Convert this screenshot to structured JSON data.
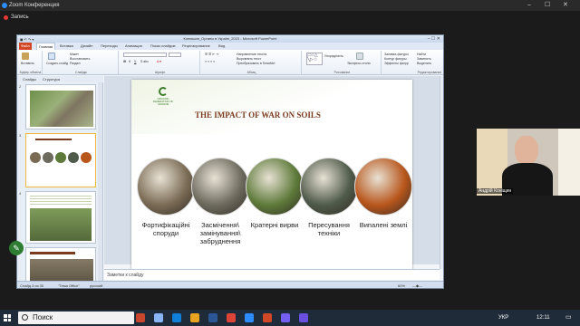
{
  "zoom": {
    "title": "Zoom Конференция",
    "recording_label": "Запись",
    "participant_name": "Андрій Коніщин",
    "window_controls": [
      "–",
      "☐",
      "✕"
    ]
  },
  "powerpoint": {
    "title": "Конюшин_Органік в Україні_2023 - Microsoft PowerPoint",
    "tabs": [
      "Файл",
      "Главная",
      "Вставка",
      "Дизайн",
      "Переходы",
      "Анимация",
      "Показ слайдов",
      "Рецензирование",
      "Вид"
    ],
    "active_tab": "Главная",
    "ribbon": {
      "groups": [
        "Буфер обмена",
        "Слайды",
        "Шрифт",
        "Абзац",
        "Рисование",
        "Редактирование"
      ],
      "buttons": {
        "paste": "Вставить",
        "create_slide": "Создать слайд",
        "layout": "Макет",
        "restore": "Восстановить",
        "section": "Раздел",
        "arrange": "Упорядочить",
        "quick_styles": "Экспресс-стили",
        "shape_fill": "Заливка фигуры",
        "shape_outline": "Контур фигуры",
        "shape_effects": "Эффекты фигур",
        "find": "Найти",
        "replace": "Заменить",
        "select": "Выделить",
        "text_direction": "Направление текста",
        "align_text": "Выровнять текст",
        "convert_smartart": "Преобразовать в SmartArt"
      }
    },
    "pane_tabs": [
      "Слайды",
      "Структура"
    ],
    "selected_slide": 3,
    "thumbnails": [
      {
        "num": "2"
      },
      {
        "num": "3"
      },
      {
        "num": "4"
      },
      {
        "num": "5"
      }
    ],
    "notes_placeholder": "Заметки к слайду",
    "status": {
      "slide": "Слайд 3 из 30",
      "theme": "\"Тема Office\"",
      "language": "русский",
      "zoom": "60%"
    }
  },
  "slide": {
    "logo_text": "ORGANIC FEDERATION OF UKRAINE",
    "title": "THE IMPACT OF WAR ON SOILS",
    "items": [
      {
        "caption": "Фортифікаційні споруди",
        "image": "trench-photo",
        "color": "#7a6b55"
      },
      {
        "caption": "Засмічення\\ замінування\\ забруднення",
        "image": "mine-photo",
        "color": "#6d6a5e"
      },
      {
        "caption": "Кратерні вирви",
        "image": "craters-photo",
        "color": "#5e7a3a"
      },
      {
        "caption": "Пересування техніки",
        "image": "military-vehicles-photo",
        "color": "#4f5a4a"
      },
      {
        "caption": "Випалені землі",
        "image": "burned-field-photo",
        "color": "#b8561c"
      }
    ]
  },
  "taskbar": {
    "search_placeholder": "Поиск",
    "language": "УКР",
    "time": "12:11"
  }
}
